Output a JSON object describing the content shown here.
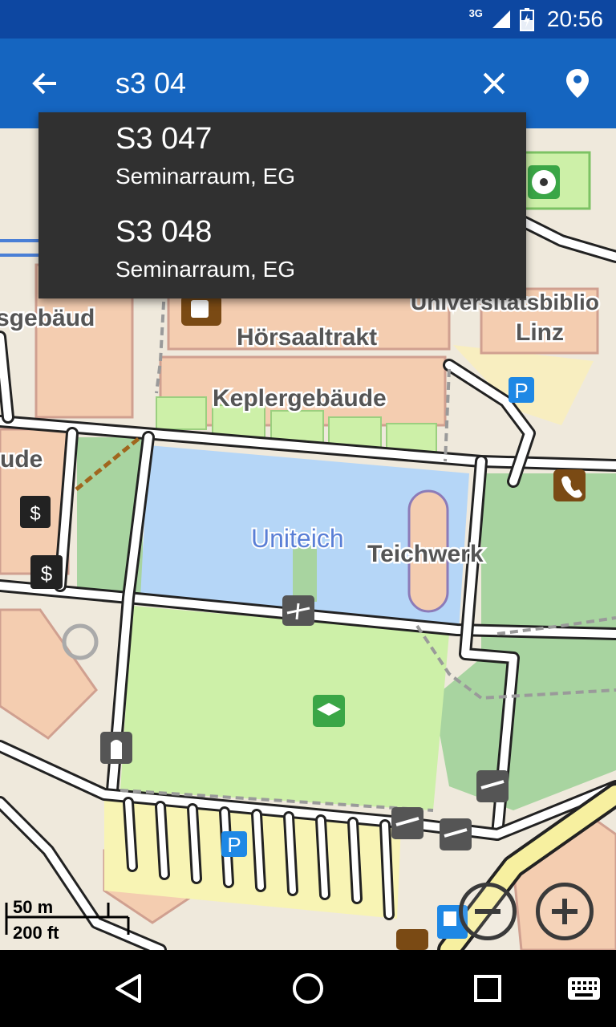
{
  "status_bar": {
    "network": "3G",
    "time": "20:56"
  },
  "search": {
    "value": "s3 04"
  },
  "suggestions": [
    {
      "title": "S3 047",
      "subtitle": "Seminarraum, EG"
    },
    {
      "title": "S3 048",
      "subtitle": "Seminarraum, EG"
    }
  ],
  "map": {
    "labels": {
      "library": "Universitätsbiblio",
      "library_line2": "Linz",
      "lecture_hall": "Hörsaaltrakt",
      "kepler": "Keplergebäude",
      "left_building": "sgebäud",
      "left_building2": "ude",
      "pond": "Uniteich",
      "teichwerk": "Teichwerk"
    },
    "scale": {
      "metric": "50 m",
      "imperial": "200 ft"
    }
  },
  "icons": {
    "back": "arrow-back-icon",
    "clear": "close-icon",
    "location": "location-pin-icon",
    "zoom_out": "zoom-out-icon",
    "zoom_in": "zoom-in-icon"
  },
  "colors": {
    "status_bar": "#0d47a1",
    "toolbar": "#1565c0",
    "suggestion_bg": "#303030",
    "water": "#b5d6f7",
    "park": "#cdf0a8",
    "building": "#f4cdb0"
  }
}
